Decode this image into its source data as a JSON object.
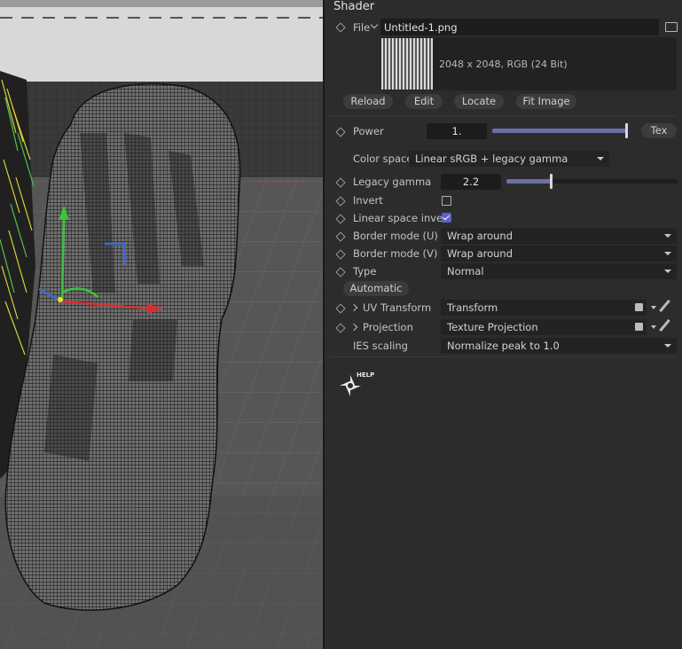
{
  "panel": {
    "title": "Shader",
    "file": {
      "label": "File",
      "value": "Untitled-1.png",
      "info": "2048 x 2048, RGB (24 Bit)"
    },
    "buttons": {
      "reload": "Reload",
      "edit": "Edit",
      "locate": "Locate",
      "fit_image": "Fit Image",
      "tex": "Tex",
      "automatic": "Automatic"
    },
    "power": {
      "label": "Power",
      "value": "1.",
      "level": 1.0
    },
    "color_space": {
      "label": "Color space",
      "value": "Linear sRGB + legacy gamma"
    },
    "legacy_gamma": {
      "label": "Legacy gamma",
      "value": "2.2",
      "level": 0.27
    },
    "invert": {
      "label": "Invert",
      "checked": false
    },
    "linear_space_invert": {
      "label": "Linear space invert",
      "checked": true
    },
    "border_u": {
      "label": "Border mode (U)",
      "value": "Wrap around"
    },
    "border_v": {
      "label": "Border mode (V)",
      "value": "Wrap around"
    },
    "type": {
      "label": "Type",
      "value": "Normal"
    },
    "uv_transform": {
      "label": "UV Transform",
      "value": "Transform"
    },
    "projection": {
      "label": "Projection",
      "value": "Texture Projection"
    },
    "ies_scaling": {
      "label": "IES scaling",
      "value": "Normalize peak to 1.0"
    },
    "help": {
      "label": "HELP",
      "icon": "octane-help-icon"
    }
  },
  "colors": {
    "panel_bg": "#2c2c2c",
    "slider_fill": "#6b6fa8",
    "checkbox_on": "#5b63c8",
    "field_bg": "#1c1c1c"
  }
}
